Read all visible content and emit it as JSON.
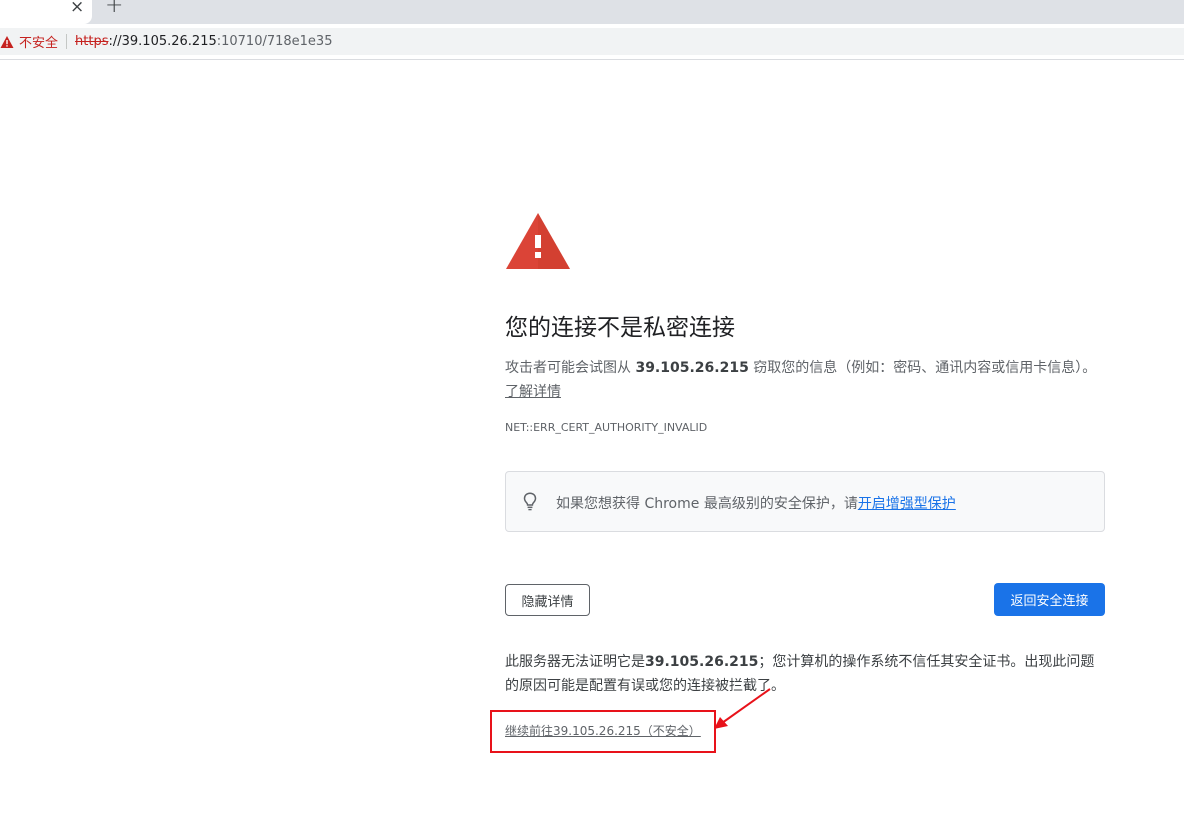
{
  "browser": {
    "tab_close_glyph": "×",
    "new_tab_glyph": "+",
    "security_label": "不安全",
    "url_scheme": "https",
    "url_sep": "://",
    "url_host": "39.105.26.215",
    "url_path": ":10710/718e1e35",
    "warning_color": "#c5221f"
  },
  "page": {
    "icon": "warning-triangle-icon",
    "icon_color": "#db4437",
    "heading": "您的连接不是私密连接",
    "desc_prefix": "攻击者可能会试图从 ",
    "desc_host": "39.105.26.215",
    "desc_suffix": " 窃取您的信息（例如：密码、通讯内容或信用卡信息）。",
    "learn_more": "了解详情",
    "error_code": "NET::ERR_CERT_AUTHORITY_INVALID",
    "tip_icon": "lightbulb-icon",
    "tip_text": "如果您想获得 Chrome 最高级别的安全保护，请",
    "tip_link": "开启增强型保护",
    "hide_details_button": "隐藏详情",
    "back_button": "返回安全连接",
    "details_prefix": "此服务器无法证明它是",
    "details_host": "39.105.26.215",
    "details_suffix": "；您计算机的操作系统不信任其安全证书。出现此问题的原因可能是配置有误或您的连接被拦截了。",
    "proceed_link": "继续前往39.105.26.215（不安全）",
    "accent_color": "#1a73e8",
    "annotation_color": "#e8121a"
  }
}
